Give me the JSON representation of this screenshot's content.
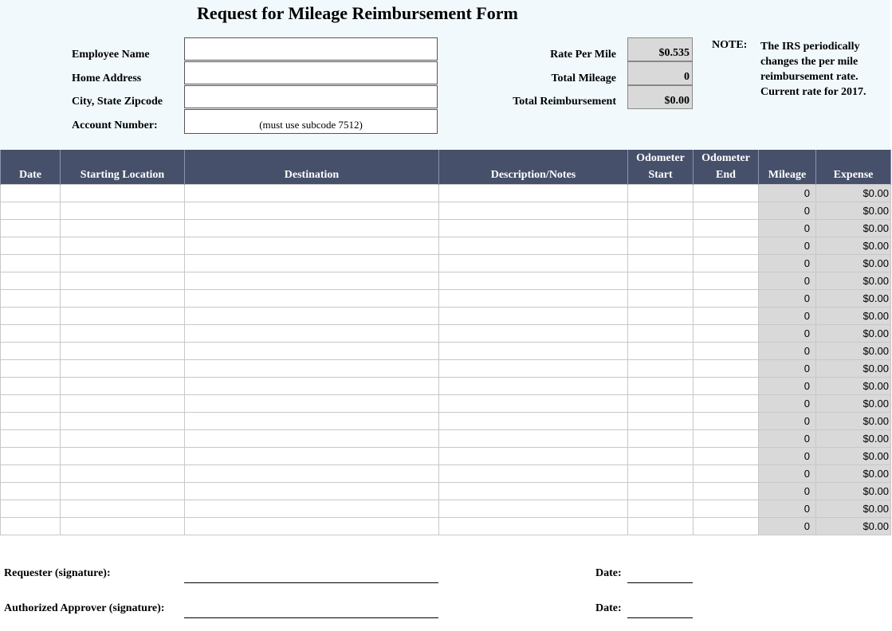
{
  "form": {
    "title": "Request for Mileage Reimbursement Form",
    "employee_name_label": "Employee Name",
    "home_address_label": "Home Address",
    "city_state_zip_label": "City, State Zipcode",
    "account_number_label": "Account Number:",
    "account_number_hint": "(must use subcode 7512)",
    "rate_per_mile_label": "Rate Per Mile",
    "rate_per_mile": "$0.535",
    "total_mileage_label": "Total Mileage",
    "total_mileage": "0",
    "total_reimbursement_label": "Total Reimbursement",
    "total_reimbursement": "$0.00",
    "note_label": "NOTE:",
    "note_text": "The IRS periodically changes the per mile reimbursement rate. Current rate for 2017."
  },
  "table": {
    "columns": [
      "Date",
      "Starting Location",
      "Destination",
      "Description/Notes",
      "Odometer Start",
      "Odometer End",
      "Mileage",
      "Expense"
    ],
    "rows": [
      {
        "mileage": "0",
        "expense": "$0.00"
      },
      {
        "mileage": "0",
        "expense": "$0.00"
      },
      {
        "mileage": "0",
        "expense": "$0.00"
      },
      {
        "mileage": "0",
        "expense": "$0.00"
      },
      {
        "mileage": "0",
        "expense": "$0.00"
      },
      {
        "mileage": "0",
        "expense": "$0.00"
      },
      {
        "mileage": "0",
        "expense": "$0.00"
      },
      {
        "mileage": "0",
        "expense": "$0.00"
      },
      {
        "mileage": "0",
        "expense": "$0.00"
      },
      {
        "mileage": "0",
        "expense": "$0.00"
      },
      {
        "mileage": "0",
        "expense": "$0.00"
      },
      {
        "mileage": "0",
        "expense": "$0.00"
      },
      {
        "mileage": "0",
        "expense": "$0.00"
      },
      {
        "mileage": "0",
        "expense": "$0.00"
      },
      {
        "mileage": "0",
        "expense": "$0.00"
      },
      {
        "mileage": "0",
        "expense": "$0.00"
      },
      {
        "mileage": "0",
        "expense": "$0.00"
      },
      {
        "mileage": "0",
        "expense": "$0.00"
      },
      {
        "mileage": "0",
        "expense": "$0.00"
      },
      {
        "mileage": "0",
        "expense": "$0.00"
      }
    ]
  },
  "signatures": {
    "requester_label": "Requester (signature):",
    "approver_label": "Authorized Approver (signature):",
    "date_label": "Date:"
  }
}
